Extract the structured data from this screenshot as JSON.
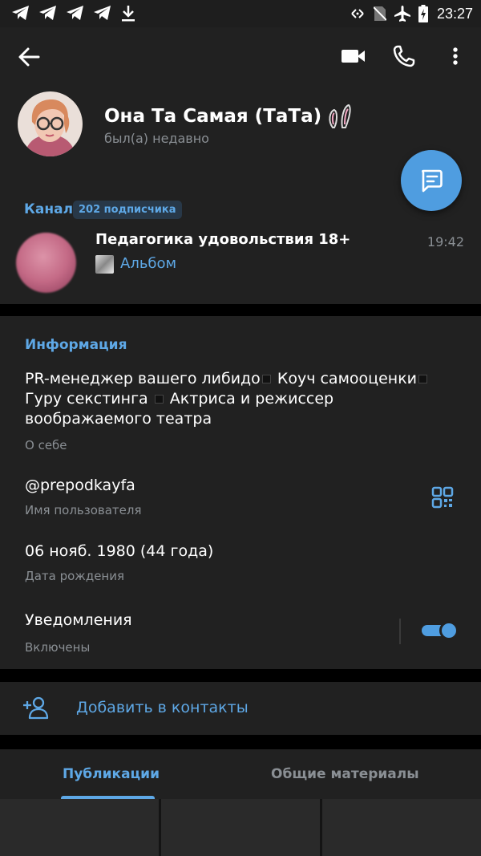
{
  "status_bar": {
    "time": "23:27",
    "left_icons": [
      "telegram-icon",
      "telegram-icon",
      "telegram-icon",
      "telegram-icon",
      "download-icon"
    ],
    "right_icons": [
      "data-saver-icon",
      "no-sim-icon",
      "airplane-icon",
      "battery-charging-icon"
    ]
  },
  "header": {
    "name": "Она Та Самая (ТаТа)",
    "status": "был(а) недавно"
  },
  "channel": {
    "label": "Канал",
    "subscribers": "202 подписчика",
    "title": "Педагогика удовольствия 18+",
    "time": "19:42",
    "last_message": "Альбом"
  },
  "info": {
    "title": "Информация",
    "bio_parts": [
      "PR-менеджер вашего либидо",
      " Коуч самооценки",
      "Гуру секстинга",
      " Актриса и режиссер воображаемого театра"
    ],
    "bio_label": "О себе",
    "username": "@prepodkayfa",
    "username_label": "Имя пользователя",
    "birthday": "06 нояб. 1980 (44 года)",
    "birthday_label": "Дата рождения",
    "notifications": "Уведомления",
    "notifications_status": "Включены",
    "notifications_enabled": true
  },
  "add_contact": {
    "label": "Добавить в контакты"
  },
  "tabs": [
    {
      "label": "Публикации",
      "active": true
    },
    {
      "label": "Общие материалы",
      "active": false
    }
  ],
  "colors": {
    "accent": "#5ea8e6",
    "fab": "#4f9de0",
    "surface": "#212121",
    "muted_text": "#8a8f94"
  }
}
